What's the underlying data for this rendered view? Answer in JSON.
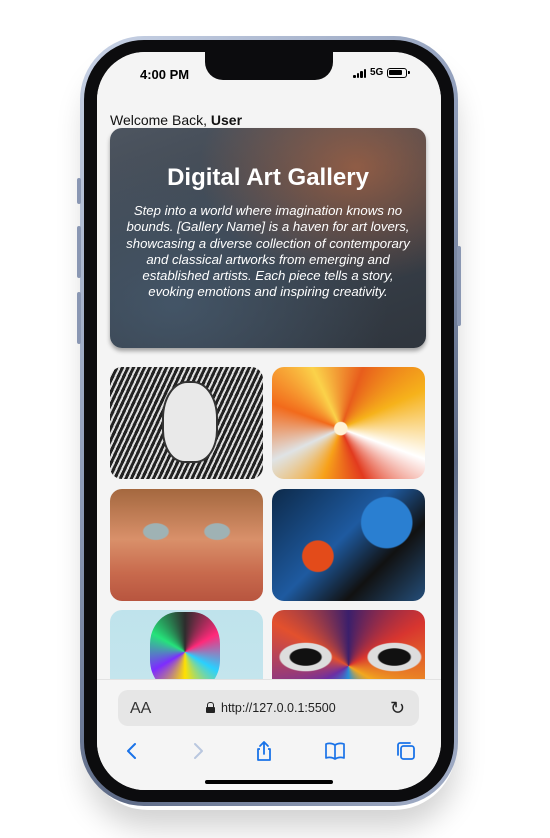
{
  "status_bar": {
    "time": "4:00 PM",
    "network": "5G",
    "icons": [
      "signal-icon",
      "battery-icon"
    ]
  },
  "welcome": {
    "prefix": "Welcome Back,",
    "user": "User"
  },
  "hero": {
    "title": "Digital Art Gallery",
    "description": "Step into a world where imagination knows no bounds. [Gallery Name] is a haven for art lovers, showcasing a diverse collection of contemporary and classical artworks from emerging and established artists. Each piece tells a story, evoking emotions and inspiring creativity."
  },
  "gallery": {
    "items": [
      {
        "subject": "line-art-portrait"
      },
      {
        "subject": "orange-fluid-burst"
      },
      {
        "subject": "street-mural-face"
      },
      {
        "subject": "blue-abstract-paint"
      },
      {
        "subject": "colorful-head-burst"
      },
      {
        "subject": "geometric-eyes-mural"
      }
    ]
  },
  "browser": {
    "text_size_label": "AA",
    "url": "http://127.0.0.1:5500",
    "nav_icons": [
      "back-icon",
      "forward-icon",
      "share-icon",
      "bookmarks-icon",
      "tabs-icon"
    ]
  },
  "colors": {
    "accent": "#1a73e8",
    "screen_background": "#f4f4f4",
    "hero_text": "#ffffff"
  }
}
